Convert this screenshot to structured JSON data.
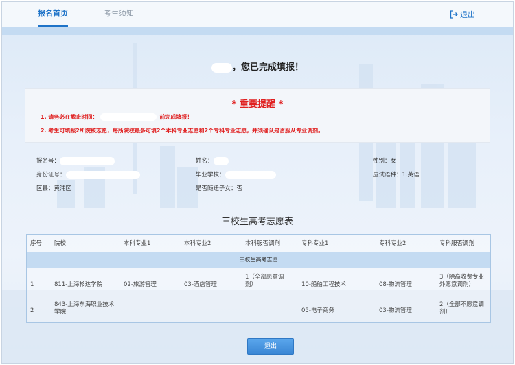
{
  "nav": {
    "tab_home": "报名首页",
    "tab_notice": "考生须知",
    "logout": "退出"
  },
  "completion_message": "，您已完成填报！",
  "notice": {
    "title": "* 重要提醒 *",
    "line1_prefix": "1. 请务必在截止时间：",
    "line1_suffix": "前完成填报！",
    "line2": "2. 考生可填报2所院校志愿，每所院校最多可填2个本科专业志愿和2个专科专业志愿，并须确认是否服从专业调剂。"
  },
  "info": {
    "reg_no_label": "报名号：",
    "name_label": "姓名：",
    "gender_label": "性别：",
    "gender_value": "女",
    "id_label": "身份证号：",
    "school_label": "毕业学校：",
    "language_label": "应试语种：",
    "language_value": "1.英语",
    "district_label": "区县：",
    "district_value": "黄浦区",
    "migrant_label": "是否随迁子女：",
    "migrant_value": "否"
  },
  "table": {
    "title": "三校生高考志愿表",
    "headers": [
      "序号",
      "院校",
      "本科专业1",
      "本科专业2",
      "本科服否调剂",
      "专科专业1",
      "专科专业2",
      "专科服否调剂"
    ],
    "group_label": "三校生高考志愿",
    "rows": [
      {
        "no": "1",
        "school": "811-上海杉达学院",
        "bk1": "02-旅游管理",
        "bk2": "03-酒店管理",
        "bk_adjust": "1（全部愿意调剂）",
        "zk1": "10-船舶工程技术",
        "zk2": "08-物流管理",
        "zk_adjust": "3（除高收费专业外愿意调剂）"
      },
      {
        "no": "2",
        "school": "843-上海东海职业技术学院",
        "bk1": "",
        "bk2": "",
        "bk_adjust": "",
        "zk1": "05-电子商务",
        "zk2": "03-物流管理",
        "zk_adjust": "2（全部不愿意调剂）"
      }
    ]
  },
  "exit_button": "退出",
  "colors": {
    "accent": "#1e73c8",
    "alert": "#e02020",
    "group_band": "#c4dbf2",
    "button": "#3a86d4"
  }
}
